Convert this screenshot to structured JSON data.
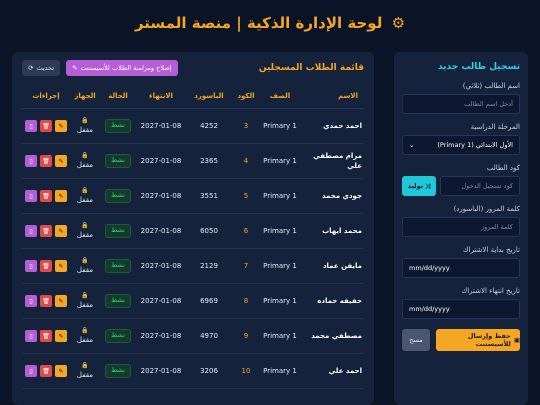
{
  "page": {
    "title": "لوحة الإدارة الذكية | منصة المستر"
  },
  "registration": {
    "title": "تسجيل طالب جديد",
    "name_label": "اسم الطالب (ثلاثي)",
    "name_placeholder": "أدخل اسم الطالب",
    "grade_label": "المرحلة الدراسية",
    "grade_value": "الأول الابتدائي (Primary 1)",
    "code_label": "كود الطالب",
    "code_placeholder": "كود تسجيل الدخول",
    "generate_label": "توليد",
    "password_label": "كلمة المرور (الباسورد)",
    "password_placeholder": "كلمة المرور",
    "start_label": "تاريخ بداية الاشتراك",
    "start_value": "mm/dd/yyyy",
    "end_label": "تاريخ انتهاء الاشتراك",
    "end_value": "mm/dd/yyyy",
    "save_label": "حفظ وإرسال للأسيستنت",
    "clear_label": "مسح"
  },
  "list": {
    "title": "قائمة الطلاب المسجلين",
    "fix_label": "إصلاح ومزامنة الطلاب للأسيستنت",
    "refresh_label": "تحديث",
    "columns": [
      "الاسم",
      "الصف",
      "الكود",
      "الباسورد",
      "الانتهاء",
      "الحالة",
      "الجهاز",
      "إجراءات"
    ],
    "rows": [
      {
        "name": "احمد حمدي",
        "grade": "Primary 1",
        "code": "3",
        "pass": "4252",
        "date": "2027-01-08",
        "status": "نشط",
        "device": "مقفل"
      },
      {
        "name": "مرام مصطفي علي",
        "grade": "Primary 1",
        "code": "4",
        "pass": "2365",
        "date": "2027-01-08",
        "status": "نشط",
        "device": "مقفل"
      },
      {
        "name": "جودي محمد",
        "grade": "Primary 1",
        "code": "5",
        "pass": "3551",
        "date": "2027-01-08",
        "status": "نشط",
        "device": "مقفل"
      },
      {
        "name": "محمد ايهاب",
        "grade": "Primary 1",
        "code": "6",
        "pass": "6050",
        "date": "2027-01-08",
        "status": "نشط",
        "device": "مقفل"
      },
      {
        "name": "مايفن عماد",
        "grade": "Primary 1",
        "code": "7",
        "pass": "2129",
        "date": "2027-01-08",
        "status": "نشط",
        "device": "مقفل"
      },
      {
        "name": "حفيفه حماده",
        "grade": "Primary 1",
        "code": "8",
        "pass": "6969",
        "date": "2027-01-08",
        "status": "نشط",
        "device": "مقفل"
      },
      {
        "name": "مصطفي محمد",
        "grade": "Primary 1",
        "code": "9",
        "pass": "4970",
        "date": "2027-01-08",
        "status": "نشط",
        "device": "مقفل"
      },
      {
        "name": "احمد علي",
        "grade": "Primary 1",
        "code": "10",
        "pass": "3206",
        "date": "2027-01-08",
        "status": "نشط",
        "device": "مقفل"
      }
    ]
  },
  "icons": {
    "gear": "gear-icon",
    "refresh": "refresh-icon",
    "pencil": "pencil-icon",
    "lock": "lock-icon",
    "edit": "edit-icon",
    "delete": "trash-icon",
    "device": "device-icon",
    "save": "save-icon",
    "shuffle": "shuffle-icon"
  },
  "colors": {
    "accent": "#f5a623",
    "cyan": "#2fd1e6",
    "active": "#34d27c",
    "danger": "#e14a4a",
    "purple": "#b45fd6"
  }
}
